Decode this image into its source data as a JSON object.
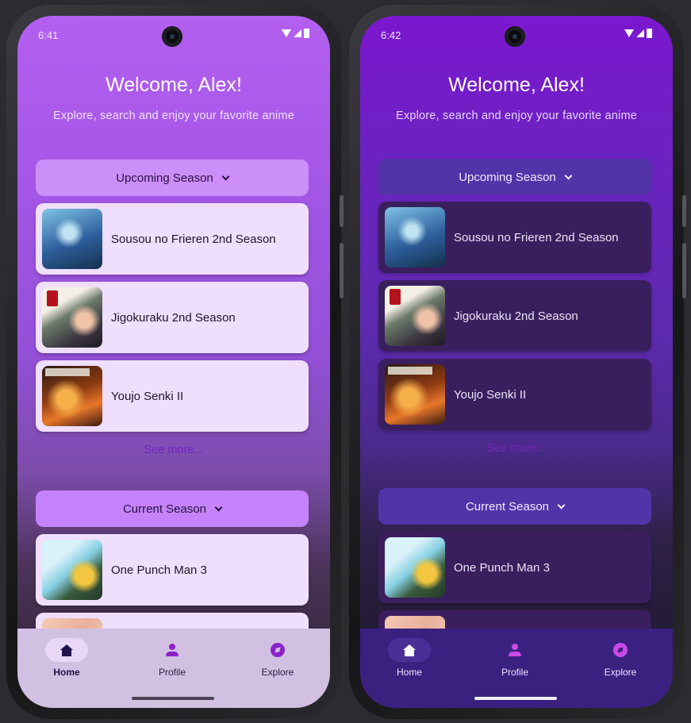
{
  "screens": [
    {
      "id": "light",
      "status_time": "6:41",
      "welcome": "Welcome, Alex!",
      "subtitle": "Explore, search and enjoy your favorite anime",
      "upcoming_label": "Upcoming Season",
      "current_label": "Current Season",
      "see_more": "See more...",
      "upcoming_items": [
        {
          "title": "Sousou no Frieren 2nd Season"
        },
        {
          "title": "Jigokuraku 2nd Season"
        },
        {
          "title": "Youjo Senki II"
        }
      ],
      "current_items": [
        {
          "title": "One Punch Man 3"
        }
      ],
      "nav": {
        "home": "Home",
        "profile": "Profile",
        "explore": "Explore"
      }
    },
    {
      "id": "dark",
      "status_time": "6:42",
      "welcome": "Welcome, Alex!",
      "subtitle": "Explore, search and enjoy your favorite anime",
      "upcoming_label": "Upcoming Season",
      "current_label": "Current Season",
      "see_more": "See more...",
      "upcoming_items": [
        {
          "title": "Sousou no Frieren 2nd Season"
        },
        {
          "title": "Jigokuraku 2nd Season"
        },
        {
          "title": "Youjo Senki II"
        }
      ],
      "current_items": [
        {
          "title": "One Punch Man 3"
        }
      ],
      "nav": {
        "home": "Home",
        "profile": "Profile",
        "explore": "Explore"
      }
    }
  ],
  "icons": {
    "camera": "front-camera-icon",
    "wifi": "wifi-icon",
    "signal": "cell-signal-icon",
    "battery": "battery-icon",
    "chevron": "chevron-down-icon",
    "home": "home-icon",
    "profile": "person-icon",
    "explore": "compass-icon"
  },
  "colors": {
    "light_accent": "#c483fb",
    "dark_accent": "#5234a8",
    "nav_accent": "#8b22c8"
  }
}
